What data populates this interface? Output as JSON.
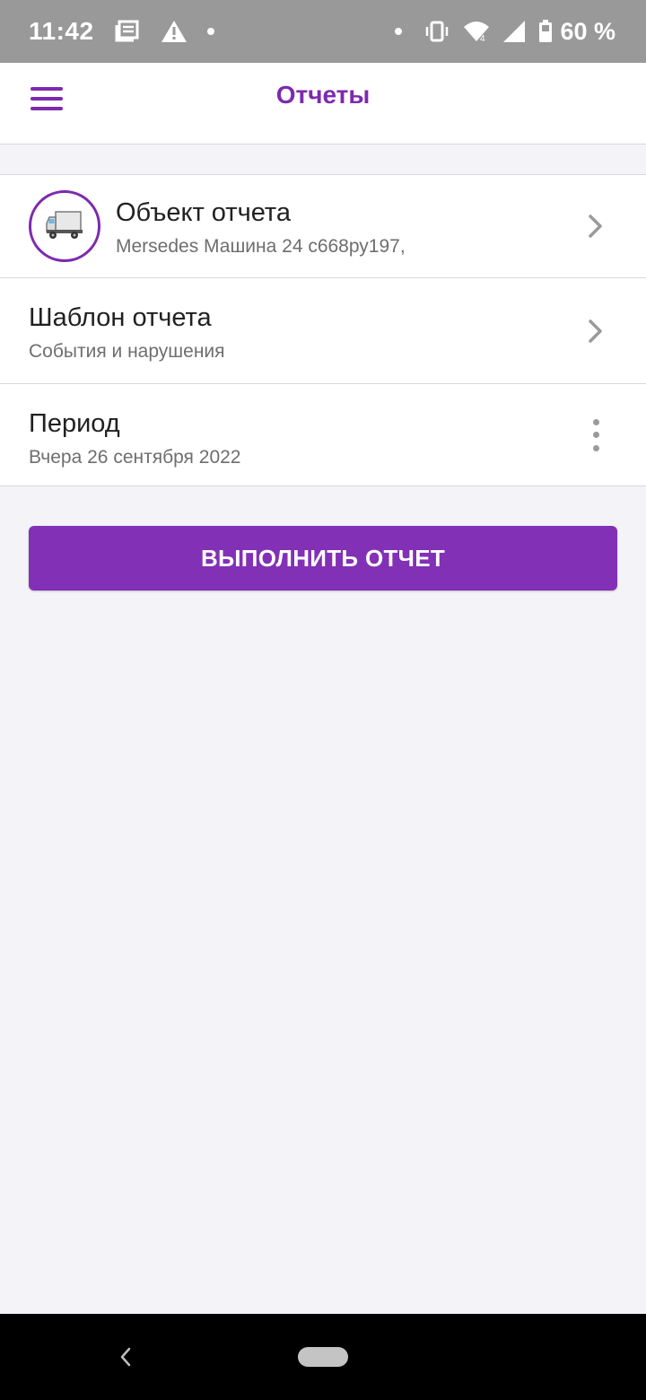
{
  "status_bar": {
    "time": "11:42",
    "battery": "60 %",
    "icons": [
      "news-icon",
      "warning-icon",
      "dot-icon",
      "dot-icon",
      "vibrate-icon",
      "wifi-icon",
      "signal-icon",
      "battery-icon"
    ]
  },
  "app_bar": {
    "title": "Отчеты",
    "menu_icon": "hamburger-menu-icon"
  },
  "list": {
    "object": {
      "title": "Объект отчета",
      "subtitle": "Mersedes Машина 24 с668ру197,",
      "icon": "truck-icon"
    },
    "template": {
      "title": "Шаблон отчета",
      "subtitle": "События и нарушения"
    },
    "period": {
      "title": "Период",
      "subtitle": "Вчера 26 сентября 2022"
    }
  },
  "actions": {
    "run_label": "ВЫПОЛНИТЬ ОТЧЕТ"
  },
  "colors": {
    "accent": "#7d2aae",
    "button": "#8230b5",
    "status_bar": "#999999",
    "background": "#f3f3f8"
  }
}
